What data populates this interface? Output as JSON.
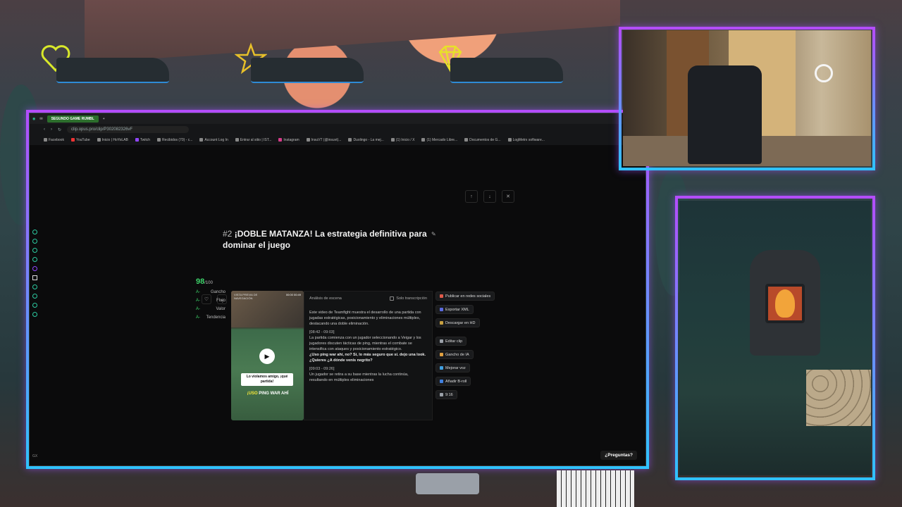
{
  "overlay": {
    "stat_icons": [
      "heart-icon",
      "star-icon",
      "diamond-icon"
    ],
    "colors": {
      "frame_top": "#b44dff",
      "frame_bottom": "#2fc2ff",
      "accent_green": "#3ed46b"
    }
  },
  "browser": {
    "tab_label": "SEGUNDO GAME RUMBL",
    "url": "clip.opus.pro/clip/P302082326vF",
    "bookmarks": [
      "Facebook",
      "YouTube",
      "Inicio | HoYoLAB",
      "Twitch",
      "Recibidos (70) - c...",
      "Account Log In",
      "Entrar al sitio | IST...",
      "Instagram",
      "InsuVT (@insuvt)...",
      "Duolingo - La mej...",
      "(1) Inicio / X",
      "(1) Mercado Libre...",
      "Documentos de G...",
      "LogMetrx software..."
    ]
  },
  "clip": {
    "number": "#2",
    "title": "¡DOBLE MATANZA! La estrategia definitiva para dominar el juego",
    "score": "98",
    "score_max": "/100",
    "metrics": [
      {
        "grade": "A-",
        "name": "Gancho"
      },
      {
        "grade": "A-",
        "name": "Flujo"
      },
      {
        "grade": "A-",
        "name": "Valor"
      },
      {
        "grade": "A-",
        "name": "Tendencia"
      }
    ],
    "video": {
      "label": "VISTA PREVIA DE NAVEGACIÓN",
      "time": "00:00 00:49",
      "caption1": "Lo violamos amigo, ¡qué partida!",
      "caption2_yellow": "¡USO",
      "caption2_white": " PING WAR AHÍ"
    },
    "analysis": {
      "heading": "Análisis de escena",
      "transcript_only": "Solo transcripción",
      "intro": "Este video de Teamfight muestra el desarrollo de una partida con jugadas estratégicas, posicionamiento y eliminaciones múltiples, destacando una doble eliminación.",
      "ts1": "[08:42 - 09:03]",
      "text1": "La partida comienza con un jugador seleccionando a Veigar y los jugadores discuten tácticas de ping, mientras el combate se intensifica con ataques y posicionamiento estratégico.",
      "quote1": "¿Uso ping war ahí, no? Sí, lo más seguro que sí. dejo una look. ¿Quieres ¿A dónde venís negrito?",
      "ts2": "[09:03 - 09:26]",
      "text2": "Un jugador se retira a su base mientras la lucha continúa, resultando en múltiples eliminaciones"
    },
    "actions": [
      {
        "label": "Publicar en redes sociales",
        "color": "#e05a4a"
      },
      {
        "label": "Exportar XML",
        "color": "#5a6ae0"
      },
      {
        "label": "Descargar en HD",
        "color": "#c8a040"
      },
      {
        "label": "Editar clip",
        "color": "#9aa0a8"
      },
      {
        "label": "Gancho de IA",
        "color": "#e0a040"
      },
      {
        "label": "Mejorar voz",
        "color": "#40a0e0"
      },
      {
        "label": "Añadir B-roll",
        "color": "#4080e0"
      },
      {
        "label": "9:16",
        "color": "#9aa0a8"
      }
    ]
  },
  "help_button": "¿Preguntas?",
  "sidebar_bottom": "GX"
}
